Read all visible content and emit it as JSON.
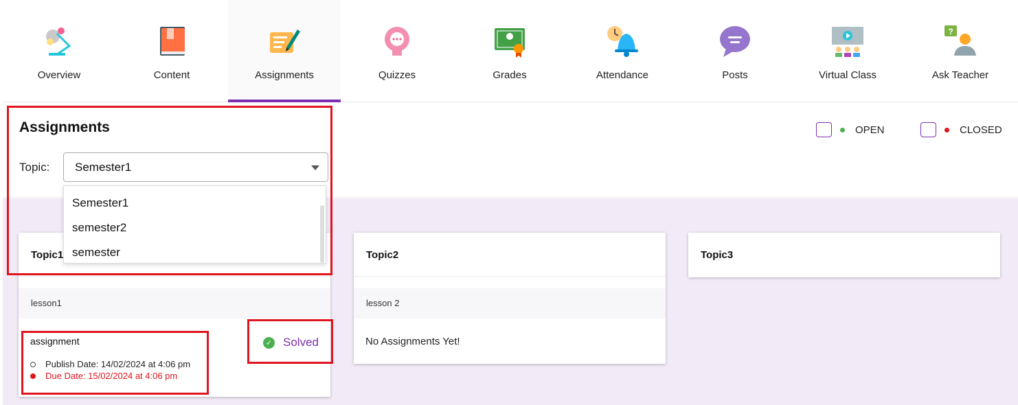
{
  "nav": {
    "items": [
      {
        "label": "Overview",
        "icon": "lamp-icon"
      },
      {
        "label": "Content",
        "icon": "book-icon"
      },
      {
        "label": "Assignments",
        "icon": "assignment-icon"
      },
      {
        "label": "Quizzes",
        "icon": "quiz-icon"
      },
      {
        "label": "Grades",
        "icon": "certificate-icon"
      },
      {
        "label": "Attendance",
        "icon": "bell-icon"
      },
      {
        "label": "Posts",
        "icon": "chat-bubble-icon"
      },
      {
        "label": "Virtual Class",
        "icon": "video-class-icon"
      },
      {
        "label": "Ask Teacher",
        "icon": "question-user-icon"
      }
    ],
    "active_index": 2,
    "active_color": "#7b2fb0"
  },
  "header": {
    "title": "Assignments",
    "topic_label": "Topic:",
    "topic_selected": "Semester1"
  },
  "dropdown": {
    "options": [
      "Semester1",
      "semester2",
      "semester"
    ]
  },
  "legend": {
    "open_label": "OPEN",
    "open_color": "#4caf50",
    "closed_label": "CLOSED",
    "closed_color": "#e0141e"
  },
  "cards": [
    {
      "title": "Topic1",
      "lesson": "lesson1",
      "assignment": {
        "name": "assignment",
        "publish": "Publish Date: 14/02/2024 at 4:06 pm",
        "due": "Due Date: 15/02/2024 at 4:06 pm",
        "status": "Solved"
      }
    },
    {
      "title": "Topic2",
      "lesson": "lesson 2",
      "empty_text": "No Assignments Yet!"
    },
    {
      "title": "Topic3"
    }
  ],
  "colors": {
    "accent": "#7b2fb0",
    "highlight_box": "#e0141e",
    "background": "#f2eaf7"
  }
}
